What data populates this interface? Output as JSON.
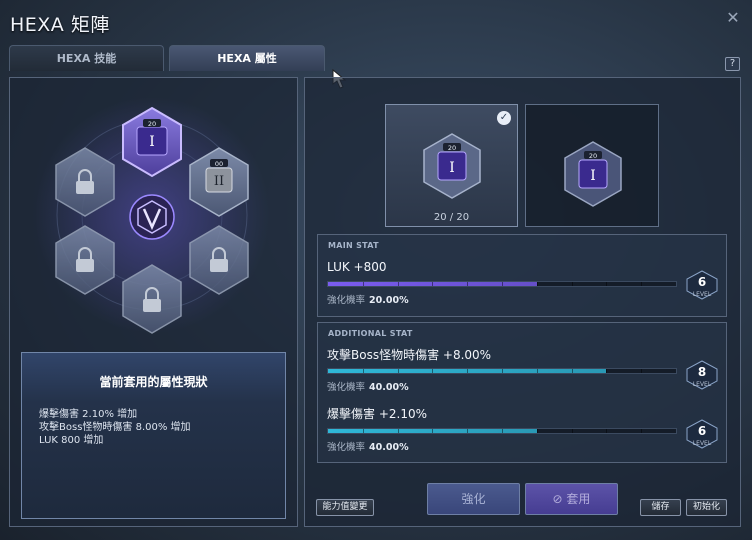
{
  "window": {
    "title": "HEXA 矩陣",
    "close_symbol": "✕",
    "help_symbol": "?"
  },
  "tabs": [
    {
      "label": "HEXA 技能",
      "active": false
    },
    {
      "label": "HEXA 屬性",
      "active": true
    }
  ],
  "hex_grid": {
    "top_slot_level": "20",
    "right_slot_level": "00",
    "top_slot_roman": "I",
    "right_slot_roman": "II",
    "locked_slots": 4
  },
  "current_status": {
    "title": "當前套用的屬性現狀",
    "lines": [
      "爆擊傷害 2.10% 增加",
      "攻擊Boss怪物時傷害 8.00% 增加",
      "LUK 800 增加"
    ]
  },
  "cards": [
    {
      "level": "20",
      "roman": "I",
      "selected": true,
      "progress": "20 / 20"
    },
    {
      "level": "20",
      "roman": "I",
      "selected": false
    }
  ],
  "main_stat": {
    "caption": "MAIN STAT",
    "name": "LUK +800",
    "fill_fraction": 0.6,
    "rate_label": "強化機率",
    "rate_value": "20.00%",
    "level": "6",
    "level_caption": "LEVEL"
  },
  "additional_stat": {
    "caption": "ADDITIONAL STAT",
    "stats": [
      {
        "name": "攻擊Boss怪物時傷害 +8.00%",
        "fill_fraction": 0.8,
        "rate_label": "強化機率",
        "rate_value": "40.00%",
        "level": "8",
        "level_caption": "LEVEL"
      },
      {
        "name": "爆擊傷害 +2.10%",
        "fill_fraction": 0.6,
        "rate_label": "強化機率",
        "rate_value": "40.00%",
        "level": "6",
        "level_caption": "LEVEL"
      }
    ]
  },
  "buttons": {
    "change_stat": "能力值變更",
    "enhance": "強化",
    "apply": "套用",
    "save": "儲存",
    "reset": "初始化"
  },
  "colors": {
    "main_bar": "#7a5cf0",
    "additional_bar": "#2fb8d8",
    "accent": "#8f7bff"
  }
}
